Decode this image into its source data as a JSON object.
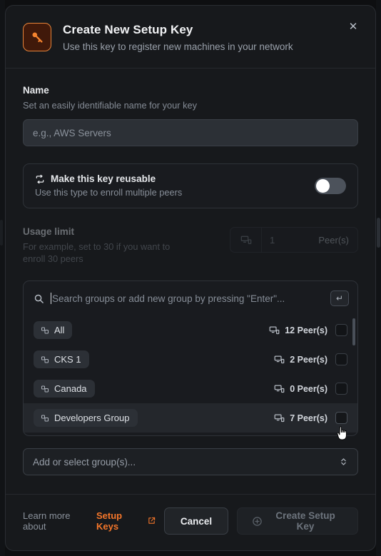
{
  "header": {
    "icon": "key-icon",
    "title": "Create New Setup Key",
    "subtitle": "Use this key to register new machines in your network",
    "close_label": "✕"
  },
  "name_section": {
    "label": "Name",
    "help": "Set an easily identifiable name for your key",
    "placeholder": "e.g., AWS Servers",
    "value": ""
  },
  "reusable_section": {
    "icon": "repeat-icon",
    "title": "Make this key reusable",
    "subtitle": "Use this type to enroll multiple peers",
    "toggle_state": "off"
  },
  "usage_section": {
    "label": "Usage limit",
    "help": "For example, set to 30 if you want to enroll 30 peers",
    "icon": "peers-icon",
    "value": "1",
    "suffix": "Peer(s)",
    "disabled": true
  },
  "group_panel": {
    "search_placeholder": "Search groups or add new group by pressing \"Enter\"...",
    "search_value": "",
    "search_icon": "search-icon",
    "enter_key_label": "↵",
    "rows": [
      {
        "name": "All",
        "peers": "12 Peer(s)",
        "checked": false,
        "hovered": false
      },
      {
        "name": "CKS 1",
        "peers": "2 Peer(s)",
        "checked": false,
        "hovered": false
      },
      {
        "name": "Canada",
        "peers": "0 Peer(s)",
        "checked": false,
        "hovered": false
      },
      {
        "name": "Developers Group",
        "peers": "7 Peer(s)",
        "checked": false,
        "hovered": true
      }
    ]
  },
  "group_select": {
    "value": "Add or select group(s)...",
    "chevron_icon": "chevron-up-down-icon"
  },
  "footer": {
    "learn_prefix": "Learn more about",
    "learn_link": "Setup Keys",
    "external_icon": "external-link-icon",
    "cancel_label": "Cancel",
    "create_label": "Create Setup Key",
    "create_icon": "plus-circle-icon",
    "create_disabled": true
  },
  "colors": {
    "accent": "#f4762a",
    "modal_bg": "#17191c",
    "page_bg": "#0e0f11",
    "input_bg": "#2c3036",
    "border": "#2e3238"
  }
}
